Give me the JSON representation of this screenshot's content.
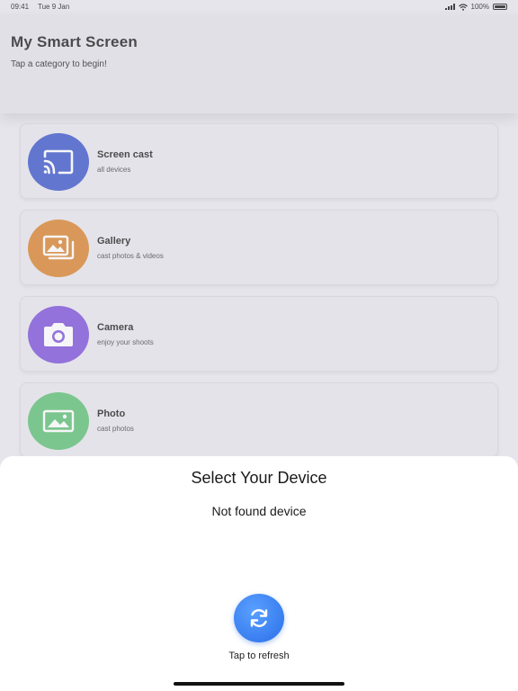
{
  "status_bar": {
    "time": "09:41",
    "date": "Tue 9 Jan",
    "battery": "100%"
  },
  "header": {
    "title": "My Smart Screen",
    "subtitle": "Tap a category to begin!"
  },
  "categories": [
    {
      "title": "Screen cast",
      "subtitle": "all devices",
      "icon": "cast-icon",
      "color": "#3a54c8"
    },
    {
      "title": "Gallery",
      "subtitle": "cast photos & videos",
      "icon": "gallery-icon",
      "color": "#d9822b"
    },
    {
      "title": "Camera",
      "subtitle": "enjoy your shoots",
      "icon": "camera-icon",
      "color": "#7b4fd8"
    },
    {
      "title": "Photo",
      "subtitle": "cast photos",
      "icon": "photo-icon",
      "color": "#5bbf72"
    }
  ],
  "sheet": {
    "title": "Select Your Device",
    "empty_message": "Not found device",
    "refresh_label": "Tap to refresh",
    "refresh_icon": "refresh-icon",
    "accent": "#3b82f6"
  }
}
